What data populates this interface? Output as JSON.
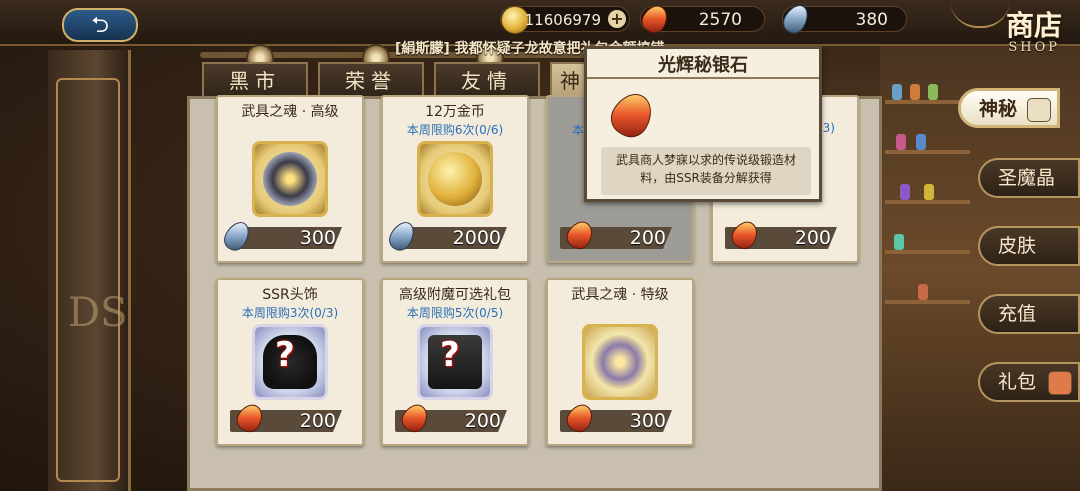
{
  "topbar": {
    "back_label": "⮌",
    "gold": "11606979",
    "red_gem": "2570",
    "blue_gem": "380",
    "shop_title": "商店",
    "shop_subtitle": "SHOP"
  },
  "marquee": "[絹斯朦] 我都怀疑子龙故意把礼包金额搞错",
  "tabs": [
    {
      "label": "黑市"
    },
    {
      "label": "荣誉"
    },
    {
      "label": "友情"
    },
    {
      "label": "神"
    }
  ],
  "tooltip": {
    "title": "光辉秘银石",
    "description": "武具商人梦寐以求的传说级锻造材料，由SSR装备分解获得"
  },
  "items": [
    {
      "title": "武具之魂 · 高级",
      "limit": "",
      "price": "300",
      "currency": "blue"
    },
    {
      "title": "12万金币",
      "limit": "本周限购6次(0/6)",
      "price": "2000",
      "currency": "blue"
    },
    {
      "title": "",
      "limit": "本",
      "price": "200",
      "currency": "red"
    },
    {
      "title": "",
      "limit": "3)",
      "price": "200",
      "currency": "red"
    },
    {
      "title": "SSR头饰",
      "limit": "本周限购3次(0/3)",
      "price": "200",
      "currency": "red"
    },
    {
      "title": "高级附魔可选礼包",
      "limit": "本周限购5次(0/5)",
      "price": "200",
      "currency": "red"
    },
    {
      "title": "武具之魂 · 特级",
      "limit": "",
      "price": "300",
      "currency": "red"
    }
  ],
  "side_nav": [
    {
      "label": "神秘",
      "active": true
    },
    {
      "label": "圣魔晶",
      "active": false
    },
    {
      "label": "皮肤",
      "active": false
    },
    {
      "label": "充值",
      "active": false
    },
    {
      "label": "礼包",
      "active": false
    }
  ],
  "left_deco_text": "DS"
}
